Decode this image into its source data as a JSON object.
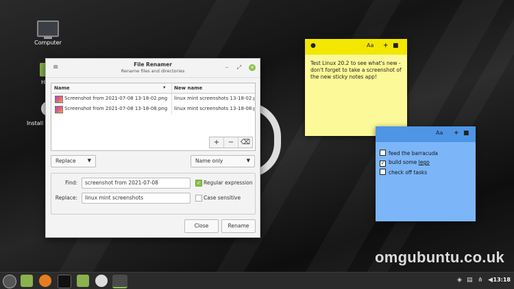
{
  "desktop": {
    "icons": [
      {
        "label": "Computer",
        "icon": "computer-icon"
      },
      {
        "label": "H",
        "icon": "folder-icon"
      },
      {
        "label": "Install L",
        "icon": "disc-icon"
      }
    ],
    "watermark": "omgubuntu.co.uk"
  },
  "window": {
    "title": "File Renamer",
    "subtitle": "Rename files and directories",
    "columns": {
      "name": "Name",
      "new_name": "New name"
    },
    "files": [
      {
        "name": "Screenshot from 2021-07-08 13-18-02.png",
        "new_name": "linux mint screenshots 13-18-02.png"
      },
      {
        "name": "Screenshot from 2021-07-08 13-18-08.png",
        "new_name": "linux mint screenshots 13-18-08.png"
      }
    ],
    "list_buttons": {
      "add": "+",
      "remove": "−",
      "clear": "⌫"
    },
    "mode_combo": "Replace",
    "scope_combo": "Name only",
    "find_label": "Find:",
    "find_value": "screenshot from 2021-07-08",
    "replace_label": "Replace:",
    "replace_value": "linux mint screenshots",
    "regex_label": "Regular expression",
    "regex_checked": true,
    "case_label": "Case sensitive",
    "case_checked": false,
    "close_label": "Close",
    "rename_label": "Rename"
  },
  "note_yellow": {
    "text": "Test Linux 20.2 to see what's new - don't forget to take a screenshot of the new sticky notes app!",
    "color": "#fcf998",
    "bar_color": "#f3e700"
  },
  "note_blue": {
    "tasks": [
      {
        "label_before": "feed the barracuda",
        "underline": "",
        "done": false
      },
      {
        "label_before": "build some ",
        "underline": "lego",
        "done": true
      },
      {
        "label_before": "check off tasks",
        "underline": "",
        "done": false
      }
    ],
    "color": "#7cb6f8",
    "bar_color": "#4f95e6"
  },
  "taskbar": {
    "clock": "13:18"
  }
}
